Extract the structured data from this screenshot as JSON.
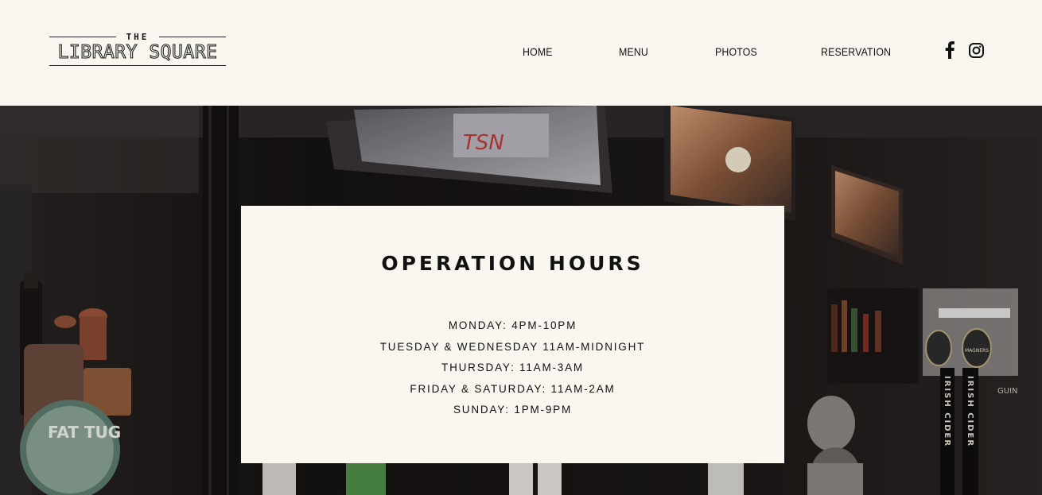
{
  "brand": {
    "logo_top": "THE",
    "logo_name": "LIBRARY SQUARE"
  },
  "nav": {
    "items": [
      "HOME",
      "MENU",
      "PHOTOS",
      "RESERVATION"
    ]
  },
  "social": {
    "facebook": "facebook-icon",
    "instagram": "instagram-icon"
  },
  "hero": {
    "signs": {
      "tv": "TSN",
      "tap": "FAT TUG",
      "cider_brand": "MAGNERS",
      "cider": "IRISH CIDER",
      "beer": "GUIN"
    }
  },
  "hours_card": {
    "title": "OPERATION HOURS",
    "lines": [
      "MONDAY: 4PM-10PM",
      "TUESDAY & WEDNESDAY 11AM-MIDNIGHT",
      "THURSDAY: 11AM-3AM",
      "FRIDAY & SATURDAY: 11AM-2AM",
      "SUNDAY: 1PM-9PM"
    ]
  },
  "colors": {
    "background": "#faf7f0",
    "text": "#111111",
    "hero_dark": "#1d1a19"
  }
}
